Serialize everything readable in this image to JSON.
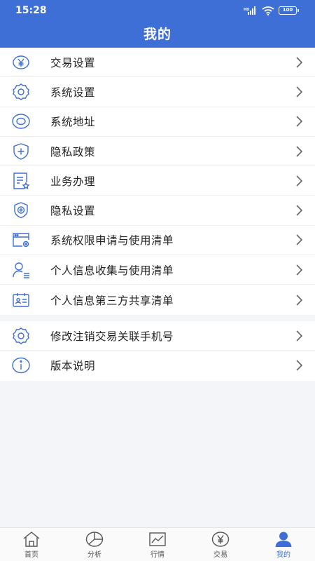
{
  "status": {
    "time": "15:28",
    "battery": "100"
  },
  "header": {
    "title": "我的"
  },
  "menu_group1": [
    {
      "label": "交易设置",
      "icon": "yen-icon"
    },
    {
      "label": "系统设置",
      "icon": "gear-icon"
    },
    {
      "label": "系统地址",
      "icon": "location-icon"
    },
    {
      "label": "隐私政策",
      "icon": "shield-plus-icon"
    },
    {
      "label": "业务办理",
      "icon": "document-star-icon"
    },
    {
      "label": "隐私设置",
      "icon": "shield-gear-icon"
    },
    {
      "label": "系统权限申请与使用清单",
      "icon": "window-gear-icon"
    },
    {
      "label": "个人信息收集与使用清单",
      "icon": "user-list-icon"
    },
    {
      "label": "个人信息第三方共享清单",
      "icon": "id-card-icon"
    }
  ],
  "menu_group2": [
    {
      "label": "修改注销交易关联手机号",
      "icon": "gear-icon"
    },
    {
      "label": "版本说明",
      "icon": "info-icon"
    }
  ],
  "tabbar": [
    {
      "label": "首页",
      "icon": "home-icon",
      "active": false
    },
    {
      "label": "分析",
      "icon": "pie-chart-icon",
      "active": false
    },
    {
      "label": "行情",
      "icon": "line-chart-icon",
      "active": false
    },
    {
      "label": "交易",
      "icon": "yen-icon",
      "active": false
    },
    {
      "label": "我的",
      "icon": "user-icon",
      "active": true
    }
  ],
  "colors": {
    "primary": "#3d6fd6",
    "icon": "#3d6fd6",
    "background": "#f4f5f9"
  }
}
